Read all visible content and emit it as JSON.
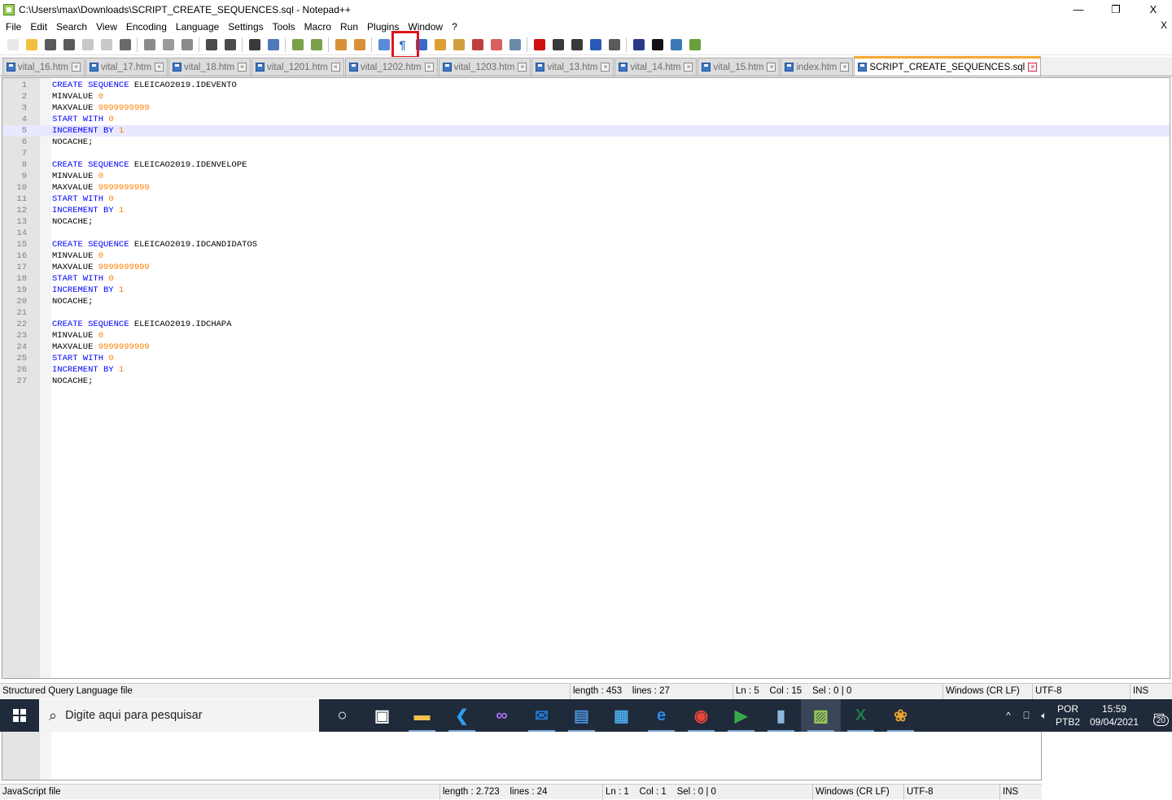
{
  "window": {
    "title": "C:\\Users\\max\\Downloads\\SCRIPT_CREATE_SEQUENCES.sql - Notepad++",
    "minimize": "—",
    "restore": "❐",
    "close": "X"
  },
  "menu": {
    "items": [
      "File",
      "Edit",
      "Search",
      "View",
      "Encoding",
      "Language",
      "Settings",
      "Tools",
      "Macro",
      "Run",
      "Plugins",
      "Window",
      "?"
    ],
    "close": "X"
  },
  "toolbar": {
    "highlighted": "show-all-characters",
    "buttons": [
      {
        "icon": "new-file-icon",
        "color": "#e8e8e8"
      },
      {
        "icon": "open-file-icon",
        "color": "#f0c040"
      },
      {
        "icon": "save-icon",
        "color": "#5a5a5a"
      },
      {
        "icon": "save-all-icon",
        "color": "#5a5a5a"
      },
      {
        "icon": "close-file-icon",
        "color": "#c8c8c8"
      },
      {
        "icon": "close-all-icon",
        "color": "#c8c8c8"
      },
      {
        "icon": "print-icon",
        "color": "#6a6a6a"
      },
      {
        "sep": true
      },
      {
        "icon": "cut-icon",
        "color": "#8a8a8a"
      },
      {
        "icon": "copy-icon",
        "color": "#9a9a9a"
      },
      {
        "icon": "paste-icon",
        "color": "#8a8a8a"
      },
      {
        "sep": true
      },
      {
        "icon": "undo-icon",
        "color": "#4a4a4a"
      },
      {
        "icon": "redo-icon",
        "color": "#4a4a4a"
      },
      {
        "sep": true
      },
      {
        "icon": "find-icon",
        "color": "#3a3a3a"
      },
      {
        "icon": "replace-icon",
        "color": "#5078b8"
      },
      {
        "sep": true
      },
      {
        "icon": "zoom-in-icon",
        "color": "#7aa04a"
      },
      {
        "icon": "zoom-out-icon",
        "color": "#7aa04a"
      },
      {
        "sep": true
      },
      {
        "icon": "sync-vertical-icon",
        "color": "#d89038"
      },
      {
        "icon": "sync-horizontal-icon",
        "color": "#d89038"
      },
      {
        "sep": true
      },
      {
        "icon": "word-wrap-icon",
        "color": "#5a8ad8"
      },
      {
        "icon": "show-all-characters-icon",
        "color": "#2a66c8",
        "glyph": "¶"
      },
      {
        "icon": "indent-guide-icon",
        "color": "#3a6ac8"
      },
      {
        "icon": "document-map-icon",
        "color": "#e0a030"
      },
      {
        "icon": "function-list-icon",
        "color": "#d0a040"
      },
      {
        "icon": "folder-as-workspace-icon",
        "color": "#c04040"
      },
      {
        "icon": "document-list-icon",
        "color": "#d86060"
      },
      {
        "icon": "monitoring-icon",
        "color": "#6a8aa8"
      },
      {
        "sep": true
      },
      {
        "icon": "record-macro-icon",
        "color": "#d01010"
      },
      {
        "icon": "stop-recording-icon",
        "color": "#3a3a3a"
      },
      {
        "icon": "playback-macro-icon",
        "color": "#3a3a3a"
      },
      {
        "icon": "run-macro-multiple-icon",
        "color": "#2a5ab8"
      },
      {
        "icon": "save-macro-icon",
        "color": "#5a5a5a"
      },
      {
        "sep": true
      },
      {
        "icon": "php-icon",
        "color": "#2a3a8a"
      },
      {
        "icon": "markdown-icon",
        "color": "#111111"
      },
      {
        "icon": "xml-tools-icon",
        "color": "#3a7ab8"
      },
      {
        "icon": "sql-icon",
        "color": "#6aa03a"
      }
    ]
  },
  "tabs": [
    {
      "label": "vital_16.htm",
      "active": false
    },
    {
      "label": "vital_17.htm",
      "active": false
    },
    {
      "label": "vital_18.htm",
      "active": false
    },
    {
      "label": "vital_1201.htm",
      "active": false
    },
    {
      "label": "vital_1202.htm",
      "active": false
    },
    {
      "label": "vital_1203.htm",
      "active": false
    },
    {
      "label": "vital_13.htm",
      "active": false
    },
    {
      "label": "vital_14.htm",
      "active": false
    },
    {
      "label": "vital_15.htm",
      "active": false
    },
    {
      "label": "index.htm",
      "active": false
    },
    {
      "label": "SCRIPT_CREATE_SEQUENCES.sql",
      "active": true
    }
  ],
  "editor": {
    "current_line": 5,
    "lines": [
      [
        {
          "t": "CREATE SEQUENCE",
          "c": "kw"
        },
        {
          "t": " ELEICAO2019.IDEVENTO"
        }
      ],
      [
        {
          "t": "MINVALUE "
        },
        {
          "t": "0",
          "c": "num"
        }
      ],
      [
        {
          "t": "MAXVALUE "
        },
        {
          "t": "9999999999",
          "c": "num"
        }
      ],
      [
        {
          "t": "START WITH",
          "c": "kw"
        },
        {
          "t": " "
        },
        {
          "t": "0",
          "c": "num"
        }
      ],
      [
        {
          "t": "INCREMENT BY",
          "c": "kw"
        },
        {
          "t": " "
        },
        {
          "t": "1",
          "c": "num"
        }
      ],
      [
        {
          "t": "NOCACHE;"
        }
      ],
      [],
      [
        {
          "t": "CREATE SEQUENCE",
          "c": "kw"
        },
        {
          "t": " ELEICAO2019.IDENVELOPE"
        }
      ],
      [
        {
          "t": "MINVALUE "
        },
        {
          "t": "0",
          "c": "num"
        }
      ],
      [
        {
          "t": "MAXVALUE "
        },
        {
          "t": "9999999999",
          "c": "num"
        }
      ],
      [
        {
          "t": "START WITH",
          "c": "kw"
        },
        {
          "t": " "
        },
        {
          "t": "0",
          "c": "num"
        }
      ],
      [
        {
          "t": "INCREMENT BY",
          "c": "kw"
        },
        {
          "t": " "
        },
        {
          "t": "1",
          "c": "num"
        }
      ],
      [
        {
          "t": "NOCACHE;"
        }
      ],
      [],
      [
        {
          "t": "CREATE SEQUENCE",
          "c": "kw"
        },
        {
          "t": " ELEICAO2019.IDCANDIDATOS"
        }
      ],
      [
        {
          "t": "MINVALUE "
        },
        {
          "t": "0",
          "c": "num"
        }
      ],
      [
        {
          "t": "MAXVALUE "
        },
        {
          "t": "9999999999",
          "c": "num"
        }
      ],
      [
        {
          "t": "START WITH",
          "c": "kw"
        },
        {
          "t": " "
        },
        {
          "t": "0",
          "c": "num"
        }
      ],
      [
        {
          "t": "INCREMENT BY",
          "c": "kw"
        },
        {
          "t": " "
        },
        {
          "t": "1",
          "c": "num"
        }
      ],
      [
        {
          "t": "NOCACHE;"
        }
      ],
      [],
      [
        {
          "t": "CREATE SEQUENCE",
          "c": "kw"
        },
        {
          "t": " ELEICAO2019.IDCHAPA"
        }
      ],
      [
        {
          "t": "MINVALUE "
        },
        {
          "t": "0",
          "c": "num"
        }
      ],
      [
        {
          "t": "MAXVALUE "
        },
        {
          "t": "9999999999",
          "c": "num"
        }
      ],
      [
        {
          "t": "START WITH",
          "c": "kw"
        },
        {
          "t": " "
        },
        {
          "t": "0",
          "c": "num"
        }
      ],
      [
        {
          "t": "INCREMENT BY",
          "c": "kw"
        },
        {
          "t": " "
        },
        {
          "t": "1",
          "c": "num"
        }
      ],
      [
        {
          "t": "NOCACHE;"
        }
      ]
    ]
  },
  "status": {
    "file_type": "Structured Query Language file",
    "length": "length : 453    lines : 27",
    "position": "Ln : 5    Col : 15    Sel : 0 | 0",
    "eol": "Windows (CR LF)",
    "encoding": "UTF-8",
    "mode": "INS"
  },
  "status2": {
    "file_type": "JavaScript file",
    "length": "length : 2.723    lines : 24",
    "position": "Ln : 1    Col : 1    Sel : 0 | 0",
    "eol": "Windows (CR LF)",
    "encoding": "UTF-8",
    "mode": "INS"
  },
  "taskbar": {
    "search_placeholder": "Digite aqui para pesquisar",
    "apps": [
      {
        "icon": "cortana-icon",
        "color": "#ffffff",
        "glyph": "○",
        "running": false
      },
      {
        "icon": "task-view-icon",
        "color": "#ffffff",
        "glyph": "▣",
        "running": false
      },
      {
        "icon": "file-explorer-icon",
        "color": "#f2c14e",
        "glyph": "▬",
        "running": true
      },
      {
        "icon": "vscode-icon",
        "color": "#2d9ef0",
        "glyph": "❮",
        "running": true
      },
      {
        "icon": "visual-studio-icon",
        "color": "#a66cf0",
        "glyph": "∞",
        "running": false
      },
      {
        "icon": "outlook-icon",
        "color": "#1f7ad6",
        "glyph": "✉",
        "running": true
      },
      {
        "icon": "remote-desktop-icon",
        "color": "#4a90d9",
        "glyph": "▤",
        "running": true
      },
      {
        "icon": "contacts-icon",
        "color": "#4aa8e8",
        "glyph": "▦",
        "running": false
      },
      {
        "icon": "edge-icon",
        "color": "#2b8ce8",
        "glyph": "e",
        "running": true
      },
      {
        "icon": "chrome-icon",
        "color": "#e8453c",
        "glyph": "◉",
        "running": true
      },
      {
        "icon": "media-player-icon",
        "color": "#3aa84a",
        "glyph": "▶",
        "running": true
      },
      {
        "icon": "notes-icon",
        "color": "#8ab8d8",
        "glyph": "▮",
        "running": true
      },
      {
        "icon": "notepadpp-icon",
        "color": "#9bcf53",
        "glyph": "▨",
        "running": true,
        "active": true
      },
      {
        "icon": "excel-icon",
        "color": "#1e7b45",
        "glyph": "X",
        "running": true
      },
      {
        "icon": "paint-icon",
        "color": "#e8a030",
        "glyph": "❀",
        "running": true
      }
    ],
    "tray": {
      "chevron": "^",
      "lang_top": "POR",
      "lang_bottom": "PTB2",
      "time": "15:59",
      "date": "09/04/2021",
      "notifications": "20"
    }
  }
}
